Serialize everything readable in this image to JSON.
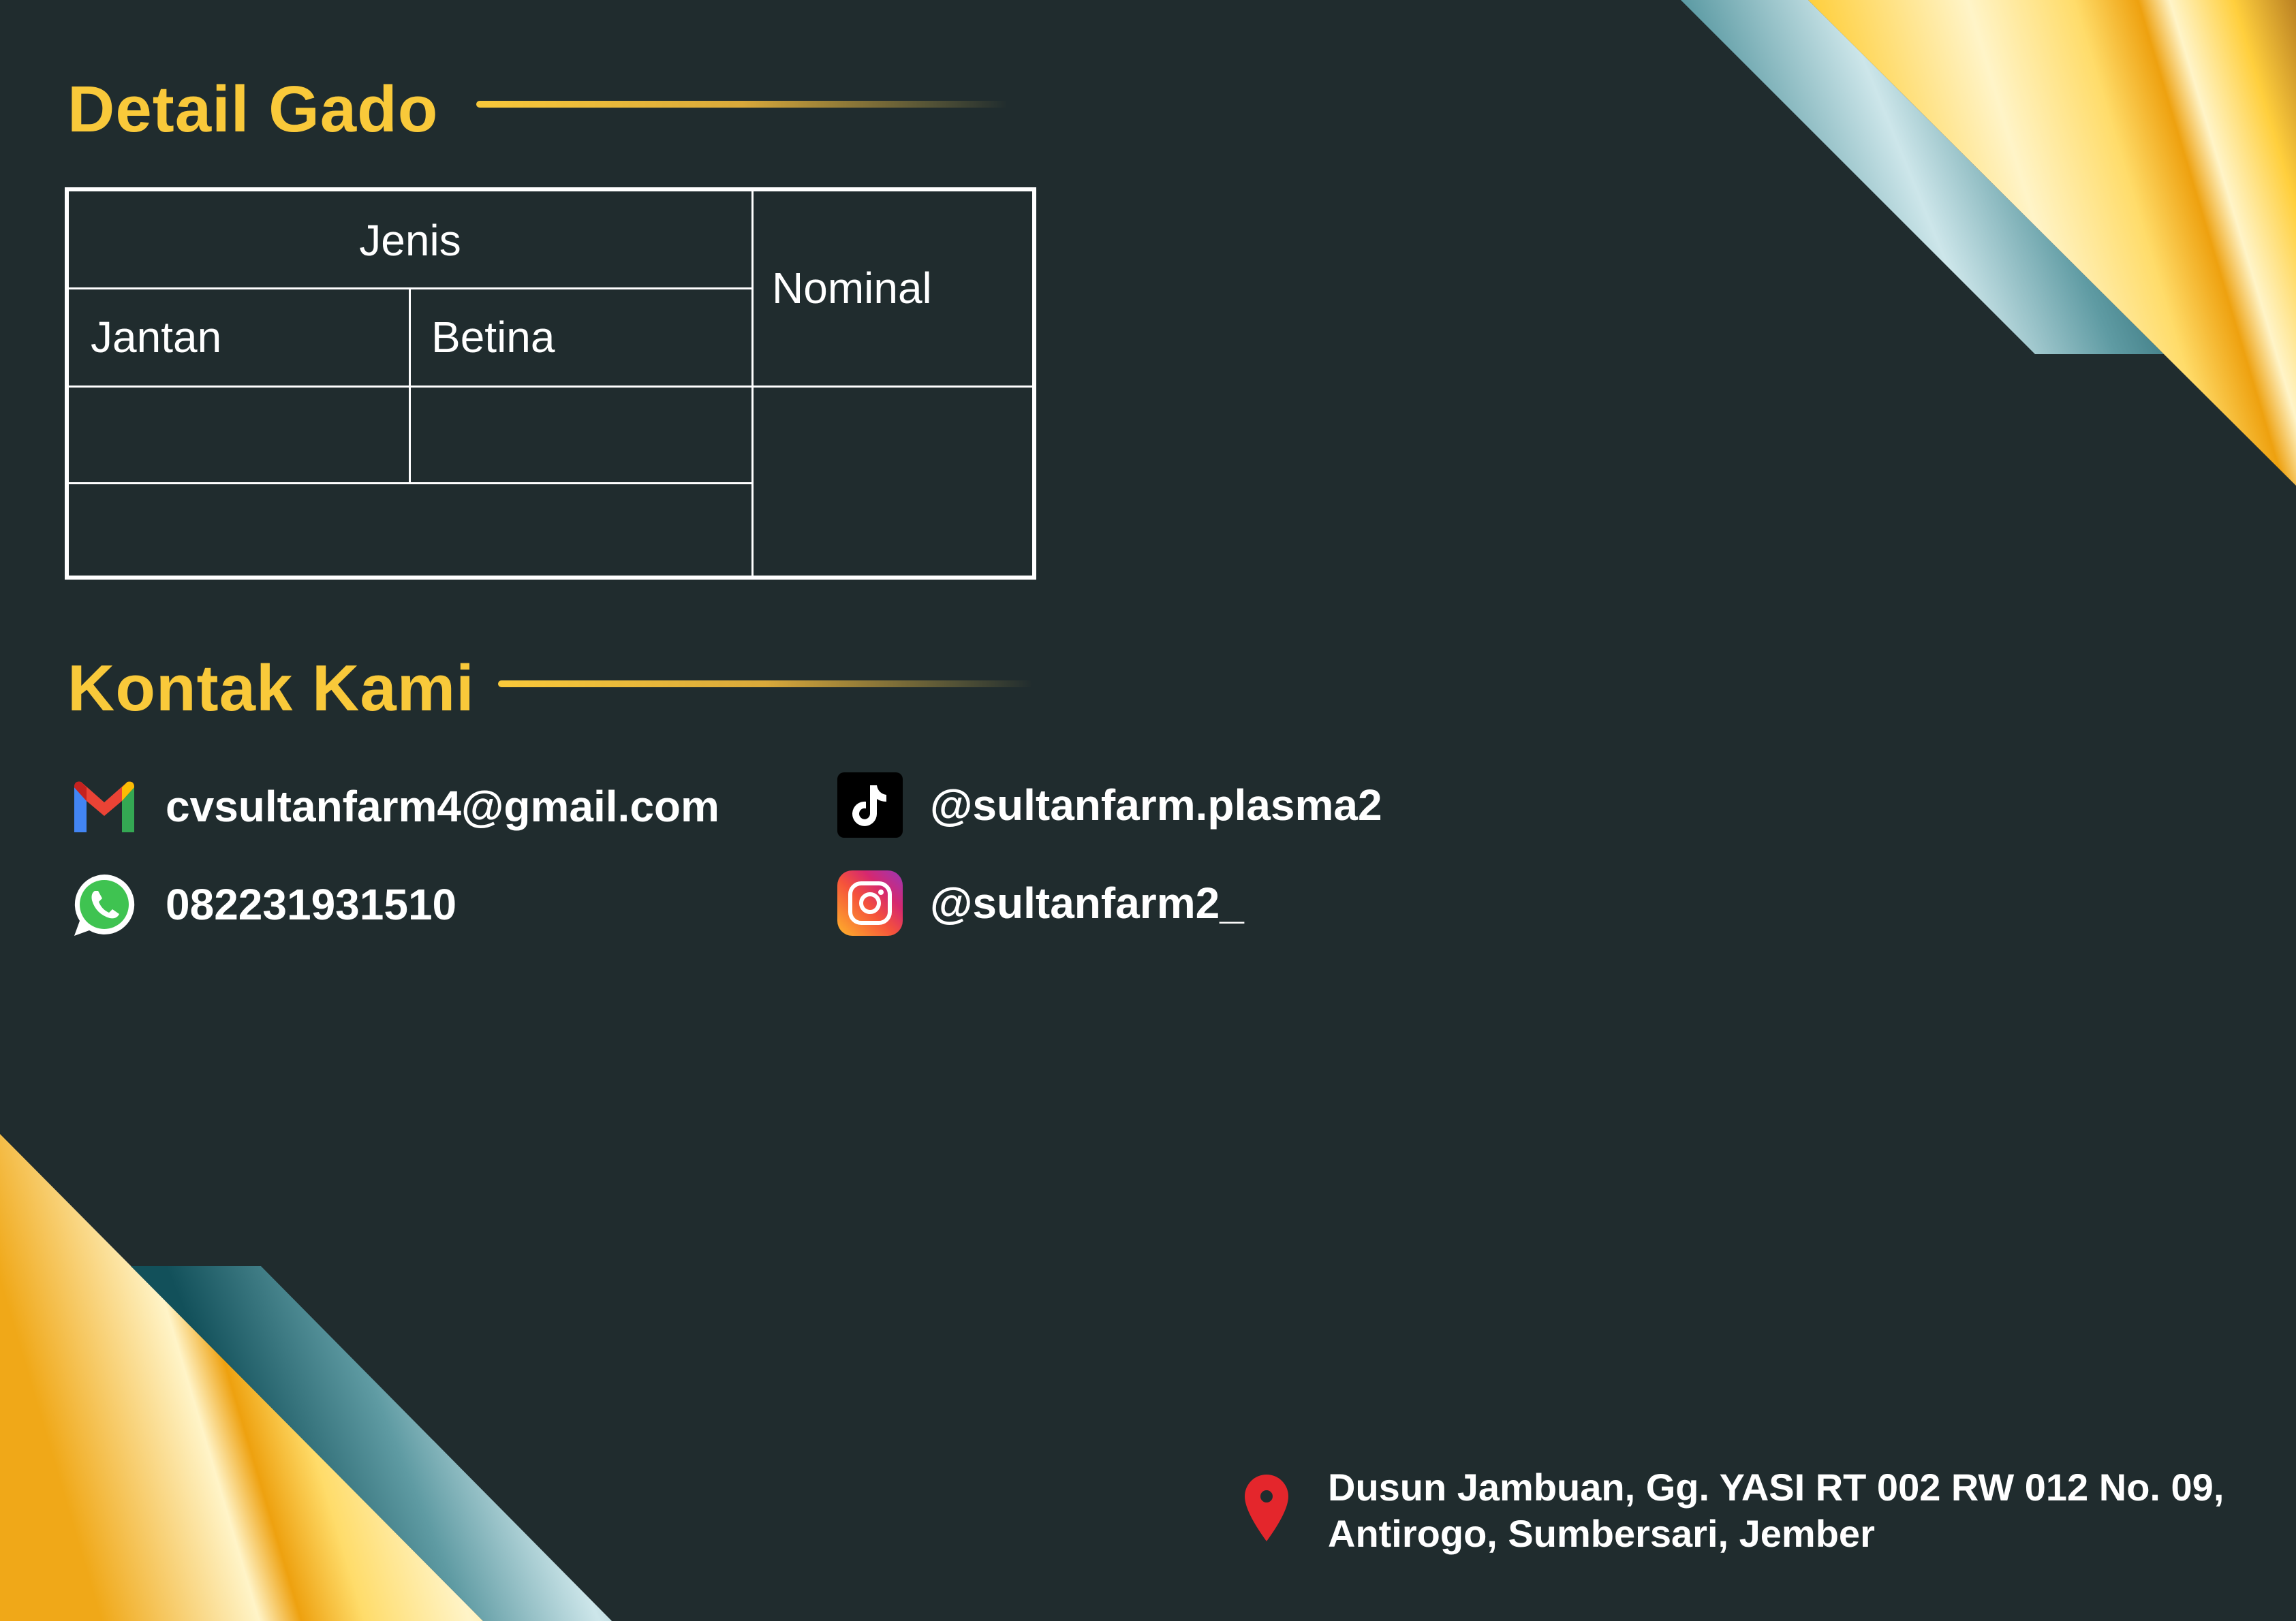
{
  "detail": {
    "title": "Detail Gado",
    "table": {
      "group_header": "Jenis",
      "col_male": "Jantan",
      "col_female": "Betina",
      "col_nominal": "Nominal"
    }
  },
  "contact": {
    "title": "Kontak Kami",
    "email": {
      "icon": "gmail-icon",
      "value": "cvsultanfarm4@gmail.com"
    },
    "phone": {
      "icon": "whatsapp-icon",
      "value": "082231931510"
    },
    "tiktok": {
      "icon": "tiktok-icon",
      "value": "@sultanfarm.plasma2"
    },
    "instagram": {
      "icon": "instagram-icon",
      "value": "@sultanfarm2_"
    }
  },
  "address": {
    "icon": "location-pin-icon",
    "line1": "Dusun Jambuan, Gg. YASI RT 002 RW 012 No. 09,",
    "line2": "Antirogo, Sumbersari, Jember"
  },
  "colors": {
    "background": "#202c2e",
    "accent": "#f9c93a",
    "teal": "#12505a",
    "pin": "#e4262c"
  }
}
